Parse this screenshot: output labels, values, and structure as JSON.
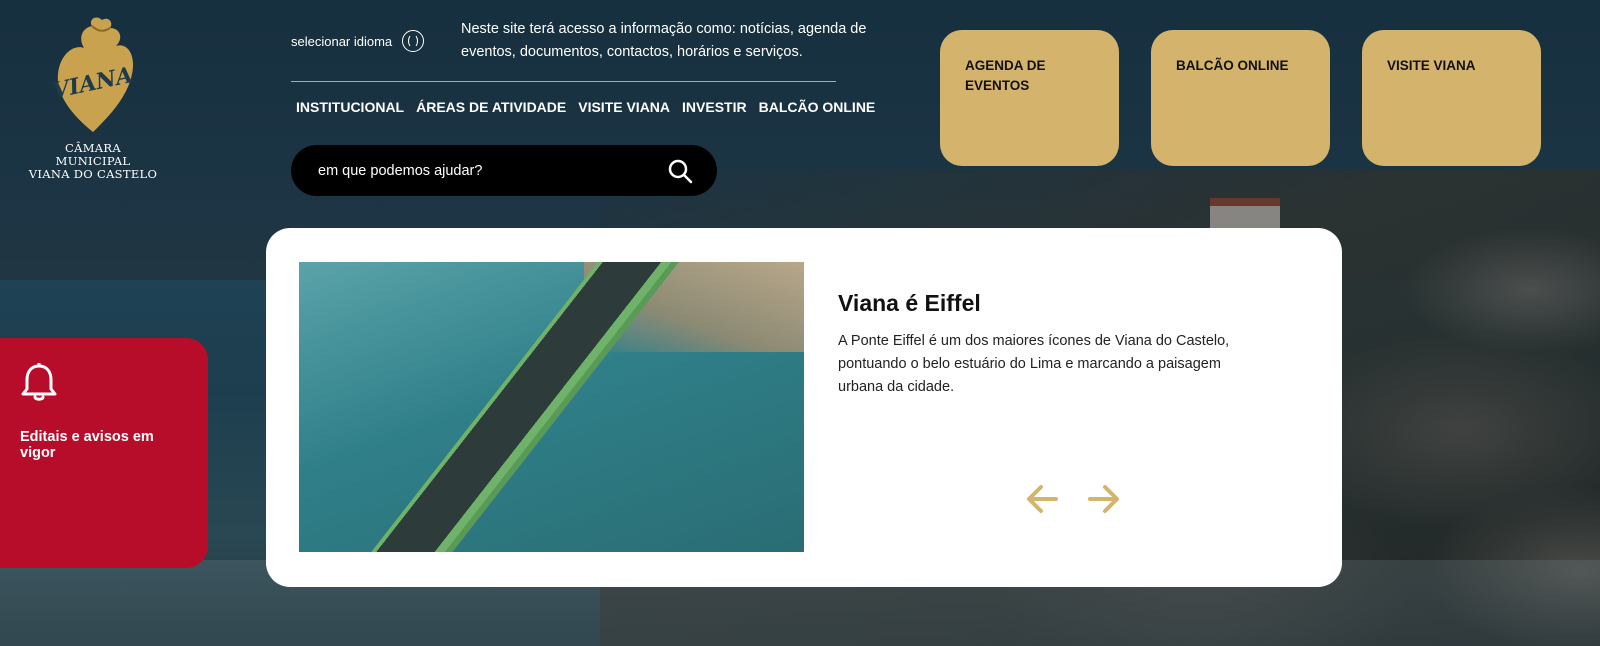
{
  "logo": {
    "mark_text": "VIANA",
    "caption_line1": "CÂMARA MUNICIPAL",
    "caption_line2": "VIANA DO CASTELO"
  },
  "language": {
    "label": "selecionar idioma",
    "icon": "globe-icon"
  },
  "intro_text": "Neste site terá acesso a informação como: notícias, agenda de eventos, documentos, contactos, horários e serviços.",
  "nav": {
    "items": [
      "INSTITUCIONAL",
      "ÁREAS DE ATIVIDADE",
      "VISITE VIANA",
      "INVESTIR",
      "BALCÃO ONLINE"
    ]
  },
  "search": {
    "placeholder": "em que podemos ajudar?",
    "icon": "search-icon"
  },
  "tiles": [
    {
      "label": "AGENDA DE EVENTOS"
    },
    {
      "label": "BALCÃO ONLINE"
    },
    {
      "label": "VISITE VIANA"
    }
  ],
  "alerts": {
    "label": "Editais e avisos em vigor",
    "icon": "bell-icon"
  },
  "carousel": {
    "title": "Viana é Eiffel",
    "description": "A Ponte Eiffel é um dos maiores ícones de Viana do Castelo, pontuando o belo estuário do Lima e marcando a paisagem urbana da cidade.",
    "prev_icon": "arrow-left-icon",
    "next_icon": "arrow-right-icon"
  },
  "colors": {
    "gold": "#d4b46d",
    "alert_red": "#b80d2a",
    "card_bg": "#ffffff",
    "search_bg": "#000000"
  }
}
